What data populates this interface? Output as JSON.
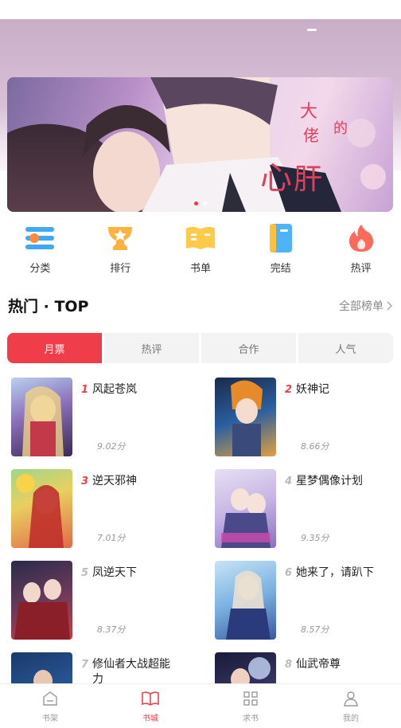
{
  "quick_nav": [
    {
      "label": "分类",
      "icon": "category-icon"
    },
    {
      "label": "排行",
      "icon": "trophy-icon"
    },
    {
      "label": "书单",
      "icon": "booklist-icon"
    },
    {
      "label": "完结",
      "icon": "finished-book-icon"
    },
    {
      "label": "热评",
      "icon": "hot-comment-icon"
    }
  ],
  "hot": {
    "title": "热门 · TOP",
    "more_label": "全部榜单"
  },
  "tabs": [
    "月票",
    "热评",
    "合作",
    "人气"
  ],
  "books": [
    {
      "rank": "1",
      "title": "风起苍岚",
      "score": "9.02分"
    },
    {
      "rank": "2",
      "title": "妖神记",
      "score": "8.66分"
    },
    {
      "rank": "3",
      "title": "逆天邪神",
      "score": "7.01分"
    },
    {
      "rank": "4",
      "title": "星梦偶像计划",
      "score": "9.35分"
    },
    {
      "rank": "5",
      "title": "凤逆天下",
      "score": "8.37分"
    },
    {
      "rank": "6",
      "title": "她来了，请趴下",
      "score": "8.57分"
    },
    {
      "rank": "7",
      "title": "修仙者大战超能力",
      "score": ""
    },
    {
      "rank": "8",
      "title": "仙武帝尊",
      "score": ""
    }
  ],
  "bottom_nav": [
    {
      "label": "书架",
      "icon": "bookshelf-icon"
    },
    {
      "label": "书城",
      "icon": "bookstore-icon"
    },
    {
      "label": "求书",
      "icon": "request-book-icon"
    },
    {
      "label": "我的",
      "icon": "profile-icon"
    }
  ],
  "colors": {
    "accent": "#ef3e4a",
    "rank_top": "#ef3e4a",
    "rank_other": "#bbbbbb"
  }
}
